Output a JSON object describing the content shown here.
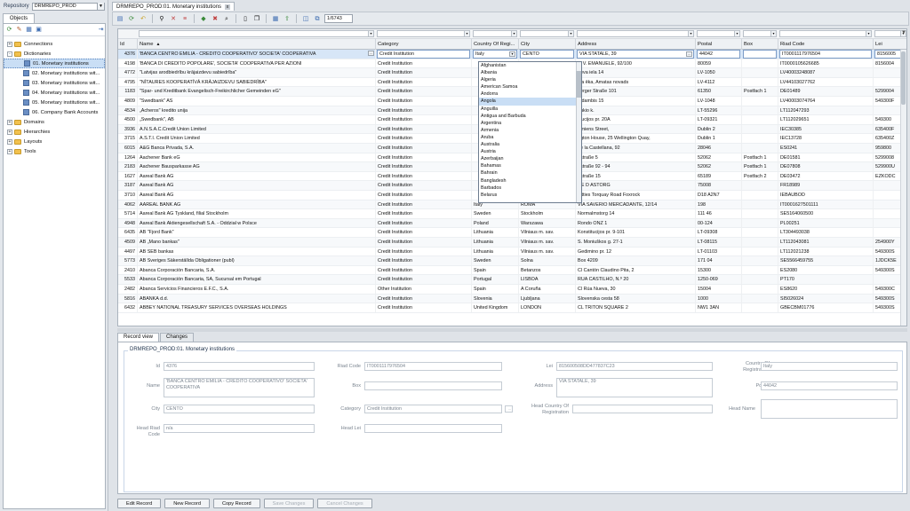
{
  "left": {
    "repository_label": "Repository",
    "repository_value": "DRMREPO_PROD",
    "tab_label": "Objects",
    "tree": [
      {
        "label": "Connections",
        "level": 0,
        "type": "folder",
        "expander": "+"
      },
      {
        "label": "Dictionaries",
        "level": 0,
        "type": "folder",
        "expander": "-"
      },
      {
        "label": "01. Monetary institutions",
        "level": 1,
        "type": "doc",
        "selected": true
      },
      {
        "label": "02. Monetary institutions wit...",
        "level": 1,
        "type": "doc"
      },
      {
        "label": "03. Monetary institutions wit...",
        "level": 1,
        "type": "doc"
      },
      {
        "label": "04. Monetary institutions wit...",
        "level": 1,
        "type": "doc"
      },
      {
        "label": "05. Monetary institutions wit...",
        "level": 1,
        "type": "doc"
      },
      {
        "label": "06. Company Bank Accounts",
        "level": 1,
        "type": "doc"
      },
      {
        "label": "Domains",
        "level": 0,
        "type": "folder",
        "expander": "+"
      },
      {
        "label": "Hierarchies",
        "level": 0,
        "type": "folder",
        "expander": "+"
      },
      {
        "label": "Layouts",
        "level": 0,
        "type": "folder",
        "expander": "+"
      },
      {
        "label": "Tools",
        "level": 0,
        "type": "folder",
        "expander": "+"
      }
    ]
  },
  "doc_tab": {
    "label": "DRMREPO_PROD:01. Monetary institutions",
    "close": "x"
  },
  "toolbar": {
    "record_counter": "1/6743"
  },
  "grid": {
    "columns": [
      "Id",
      "Name",
      "Category",
      "Country Of Regi...",
      "City",
      "Address",
      "Postal",
      "Box",
      "Riad Code",
      "Lei"
    ],
    "sort_indicator": "▲",
    "edit_row": {
      "id": "4376",
      "name": "'BANCA CENTRO EMILIA - CREDITO COOPERATIVO' SOCIETA' COOPERATIVA",
      "category": "Credit Institution",
      "country": "Italy",
      "city": "CENTO",
      "address": "VIA STATALE, 39",
      "postal": "44042",
      "box": "",
      "riad": "IT0001117976504",
      "lei": "8156005"
    },
    "rows": [
      [
        "4198",
        "'BANCA DI CREDITO POPOLARE', SOCIETA' COOPERATIVA PER AZIONI",
        "Credit Institution",
        "",
        "",
        "O V. EMANUELE, 92/100",
        "80059",
        "",
        "IT0000105626685",
        "8156004"
      ],
      [
        "4772",
        "\"Latvijas arodbiedrību krājaizdevu sabiedrība\"",
        "Credit Institution",
        "",
        "",
        "neva iela 14",
        "LV-1050",
        "",
        "LV40003248087",
        ""
      ],
      [
        "4795",
        "\"NĪTAURES KOOPERATĪVĀ KRĀJAIZDEVU SABIEDRĪBA\"",
        "Credit Institution",
        "",
        "",
        "sta ēka, Amatas novads",
        "LV-4112",
        "",
        "LV44103027762",
        ""
      ],
      [
        "1183",
        "\"Spar- und Kreditbank Evangelisch-Freikirchlicher Gemeinden eG\"",
        "Credit Institution",
        "",
        "",
        "berger Straße 101",
        "61350",
        "Postfach 1",
        "DE01489",
        "5299004"
      ],
      [
        "4809",
        "\"Swedbank\" AS",
        "Credit Institution",
        "",
        "",
        "a dambis 15",
        "LV-1048",
        "",
        "LV40003074764",
        "549300F"
      ],
      [
        "4534",
        "„Acheros\" kredito unija",
        "Credit Institution",
        "",
        "",
        "oukio k.",
        "LT-55296",
        "",
        "LT112047293",
        ""
      ],
      [
        "4500",
        "„Swedbank\", AB",
        "Credit Institution",
        "",
        "",
        "stucijos pr. 20A",
        "LT-09321",
        "",
        "LT112029651",
        "549300"
      ],
      [
        "3936",
        "A.N.S.A.C.Credit Union Limited",
        "Credit Institution",
        "",
        "",
        "Amiens Street,",
        "Dublin 2",
        "",
        "IEC30385",
        "635400F"
      ],
      [
        "3715",
        "A.S.T.I. Credit Union Limited",
        "Credit Institution",
        "",
        "",
        "ngton House, 25 Wellington Quay,",
        "Dublin 1",
        "",
        "IEC13728",
        "635400Z"
      ],
      [
        "6015",
        "A&G Banca Privada, S.A.",
        "Credit Institution",
        "",
        "",
        "de la Castellana, 92",
        "28046",
        "",
        "ES0241",
        "959800"
      ],
      [
        "1264",
        "Aachener Bank eG",
        "Credit Institution",
        "",
        "",
        "nstraße 5",
        "52062",
        "Postfach 1",
        "DE01581",
        "5299008"
      ],
      [
        "2183",
        "Aachener Bausparkasse AG",
        "Credit Institution",
        "",
        "",
        "nstraße 92 - 94",
        "52062",
        "Postfach 1",
        "DE07808",
        "529900U"
      ],
      [
        "1627",
        "Aareal Bank AG",
        "Credit Institution",
        "",
        "",
        "nstraße 15",
        "65189",
        "Postfach 2",
        "DE03472",
        "EZKODC"
      ],
      [
        "3187",
        "Aareal Bank AG",
        "Credit Institution",
        "",
        "",
        "UE D ASTORG",
        "75008",
        "",
        "FR18989",
        ""
      ],
      [
        "3710",
        "Aareal Bank AG",
        "Credit Institution",
        "",
        "",
        "tatties Torquay Road Foxrock",
        "D18 A2N7",
        "",
        "IEBAUBOD",
        ""
      ],
      [
        "4062",
        "AAREAL BANK AG",
        "Credit Institution",
        "Italy",
        "ROMA",
        "VIA SAVERIO MERCADANTE, 12/14",
        "198",
        "",
        "IT0001627501111",
        ""
      ],
      [
        "5714",
        "Aareal Bank AG Tyskland, filial Stockholm",
        "Credit Institution",
        "Sweden",
        "Stockholm",
        "Normalmstorg 14",
        "111 46",
        "",
        "SE5164060500",
        ""
      ],
      [
        "4948",
        "Aareal Bank Aktiengesellschaft S.A. - Oddział w Polsce",
        "Credit Institution",
        "Poland",
        "Warszawa",
        "Rondo ONZ 1",
        "00-124",
        "",
        "PL00251",
        ""
      ],
      [
        "6435",
        "AB \"Fjord Bank\"",
        "Credit Institution",
        "Lithuania",
        "Vilniaus m. sav.",
        "Konstitucijos pr. 9-101",
        "LT-09308",
        "",
        "LT304493038",
        ""
      ],
      [
        "4509",
        "AB „Mano bankas\"",
        "Credit Institution",
        "Lithuania",
        "Vilniaus m. sav.",
        "S. Moniuškos g. 27-1",
        "LT-08115",
        "",
        "LT112043081",
        "254900Y"
      ],
      [
        "4497",
        "AB SEB bankas",
        "Credit Institution",
        "Lithuania",
        "Vilniaus m. sav.",
        "Gedimino pr. 12",
        "LT-01103",
        "",
        "LT112021238",
        "549300S"
      ],
      [
        "5773",
        "AB Sveriges Säkerställda Obligationer (publ)",
        "Credit Institution",
        "Sweden",
        "Solna",
        "Box 4209",
        "171 04",
        "",
        "SE5566459755",
        "1JDCK5E"
      ],
      [
        "2410",
        "Abanca Corporación Bancaria, S.A.",
        "Credit Institution",
        "Spain",
        "Betanzos",
        "Cl Cantón Claudino Pita, 2",
        "15300",
        "",
        "ES2080",
        "549300S"
      ],
      [
        "5533",
        "Abanca Corporación Bancaria, SA, Sucursal em Portugal",
        "Credit Institution",
        "Portugal",
        "LISBOA",
        "RUA CASTILHO, N.º 20",
        "1250-069",
        "",
        "PT170",
        ""
      ],
      [
        "2482",
        "Abanca Servicios Financieros E.F.C., S.A.",
        "Other Institution",
        "Spain",
        "A Coruña",
        "Cl Rúa Nueva, 30",
        "15004",
        "",
        "ES8620",
        "549300C"
      ],
      [
        "5816",
        "ABANKA d.d.",
        "Credit Institution",
        "Slovenia",
        "Ljubljana",
        "Slovenska cesta 58",
        "1000",
        "",
        "SI5026024",
        "549300S"
      ],
      [
        "6432",
        "ABBEY NATIONAL TREASURY SERVICES OVERSEAS HOLDINGS",
        "Credit Institution",
        "United Kingdom",
        "LONDON",
        "CL TRITON SQUARE 2",
        "NW1 3AN",
        "",
        "GBECBM01776",
        "549300S"
      ]
    ]
  },
  "country_dropdown": {
    "items": [
      "Afghanistan",
      "Albania",
      "Algeria",
      "American Samoa",
      "Andorra",
      "Angola",
      "Anguilla",
      "Antigua and Barbuda",
      "Argentina",
      "Armenia",
      "Aruba",
      "Australia",
      "Austria",
      "Azerbaijan",
      "Bahamas",
      "Bahrain",
      "Bangladesh",
      "Barbados",
      "Belarus"
    ],
    "highlighted": "Angola"
  },
  "bottom_tabs": [
    "Record view",
    "Changes"
  ],
  "record": {
    "legend": "DRMREPO_PROD:01. Monetary institutions",
    "labels": {
      "id": "Id",
      "riad_code": "Riad Code",
      "lei": "Lei",
      "country": "Country Of Registration",
      "name": "Name",
      "box": "Box",
      "address": "Address",
      "postal": "Postal",
      "city": "City",
      "category": "Category",
      "head_country": "Head Country Of Registration",
      "head_name": "Head Name",
      "head_riad": "Head Riad Code",
      "head_lei": "Head Lei"
    },
    "values": {
      "id": "4376",
      "riad_code": "IT0001117976504",
      "lei": "815600508DD477837C23",
      "country": "Italy",
      "name": "'BANCA CENTRO EMILIA - CREDITO COOPERATIVO' SOCIETA' COOPERATIVA",
      "box": "",
      "address": "VIA STATALE, 39",
      "postal": "44042",
      "city": "CENTO",
      "category": "Credit Institution",
      "head_country": "",
      "head_name": "",
      "head_riad": "n/a",
      "head_lei": ""
    }
  },
  "buttons": {
    "edit": "Edit Record",
    "new": "New Record",
    "copy": "Copy Record",
    "save": "Save Changes",
    "cancel": "Cancel Changes"
  }
}
